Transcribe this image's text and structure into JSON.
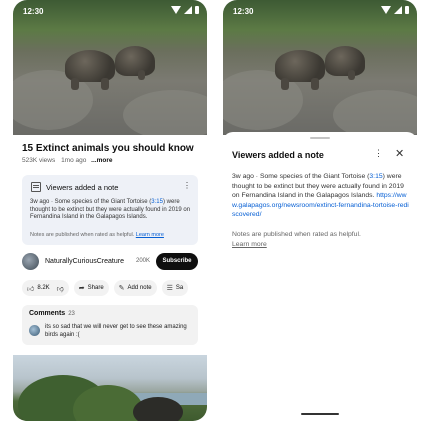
{
  "status_bar": {
    "time": "12:30"
  },
  "video": {
    "title": "15 Extinct animals you should know",
    "views": "523K views",
    "age": "1mo ago",
    "more_label": "...more"
  },
  "note_card": {
    "header": "Viewers added a note",
    "body_prefix": "3w ago · Some species of the Giant Tortoise (",
    "body_link": "3:15",
    "body_suffix": ") were thought to be extinct but they were actually found in 2019 on Fernandina Island in the Galapagos Islands.",
    "footer_prefix": "Notes are published when rated as helpful. ",
    "footer_link": "Learn more"
  },
  "channel": {
    "name": "NaturallyCuriousCreature",
    "subscribers": "200K",
    "subscribe_label": "Subscribe"
  },
  "actions": {
    "like_count": "8.2K",
    "share_label": "Share",
    "add_note_label": "Add note",
    "save_label": "Sa"
  },
  "comments": {
    "title": "Comments",
    "count": "23",
    "top_comment": "its so sad that we will never get to see these amazing birds again :("
  },
  "sheet": {
    "title": "Viewers added a note",
    "body_prefix": "3w ago · Some species of the Giant Tortoise (",
    "body_timestamp": "3:15",
    "body_middle": ") were thought to be extinct but they were actually found in 2019 on Fernandina Island in the Galapagos Islands. ",
    "body_url": "https://www.galapagos.org/newsroom/extinct-fernandina-tortoise-rediscovered/",
    "footer_text": "Notes are published when rated as helpful.",
    "footer_link": "Learn more"
  },
  "icons": {
    "wifi": "wifi-icon",
    "signal": "signal-icon",
    "battery": "battery-icon",
    "note": "note-icon",
    "like": "thumbs-up-icon",
    "dislike": "thumbs-down-icon",
    "share": "share-icon",
    "add_note": "add-note-icon",
    "save": "save-icon",
    "more": "more-vert-icon",
    "close": "close-icon"
  }
}
